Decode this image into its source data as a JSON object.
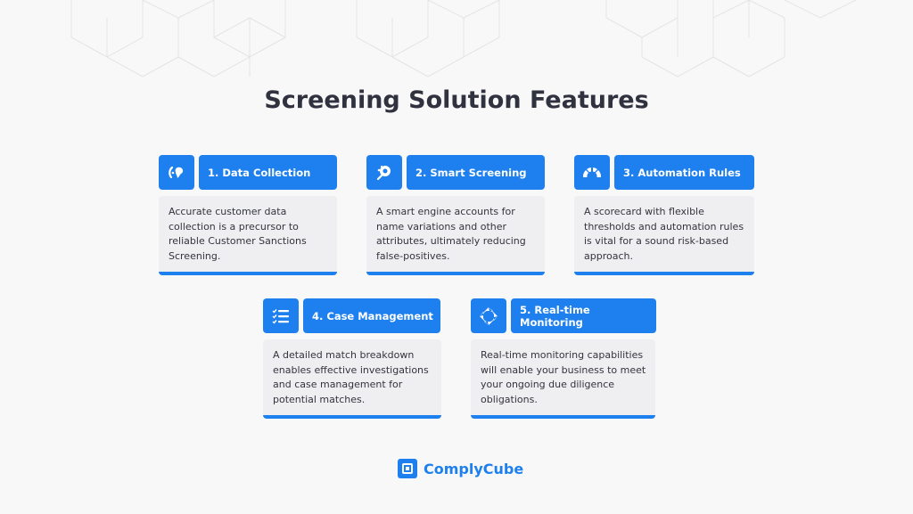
{
  "title": "Screening Solution Features",
  "colors": {
    "accent": "#1e80ee",
    "text": "#30323f",
    "card_bg": "#efeff1",
    "page_bg": "#f8f8f9"
  },
  "features": [
    {
      "icon": "globe-icon",
      "label": "1. Data Collection",
      "description": "Accurate customer data collection is a precursor to reliable Customer Sanctions Screening."
    },
    {
      "icon": "smart-engine-icon",
      "label": "2. Smart Screening",
      "description": "A smart engine accounts for name variations and other attributes, ultimately reducing false-positives."
    },
    {
      "icon": "gauge-icon",
      "label": "3. Automation Rules",
      "description": "A scorecard with flexible thresholds and automation rules is vital for a sound risk-based approach."
    },
    {
      "icon": "checklist-icon",
      "label": "4. Case Management",
      "description": "A detailed match breakdown enables effective investigations and case management for potential matches."
    },
    {
      "icon": "cycle-arrows-icon",
      "label": "5. Real-time Monitoring",
      "description": "Real-time monitoring capabilities will enable your business to meet your ongoing due diligence obligations."
    }
  ],
  "brand": {
    "name": "ComplyCube",
    "icon": "complycube-logo-icon"
  }
}
